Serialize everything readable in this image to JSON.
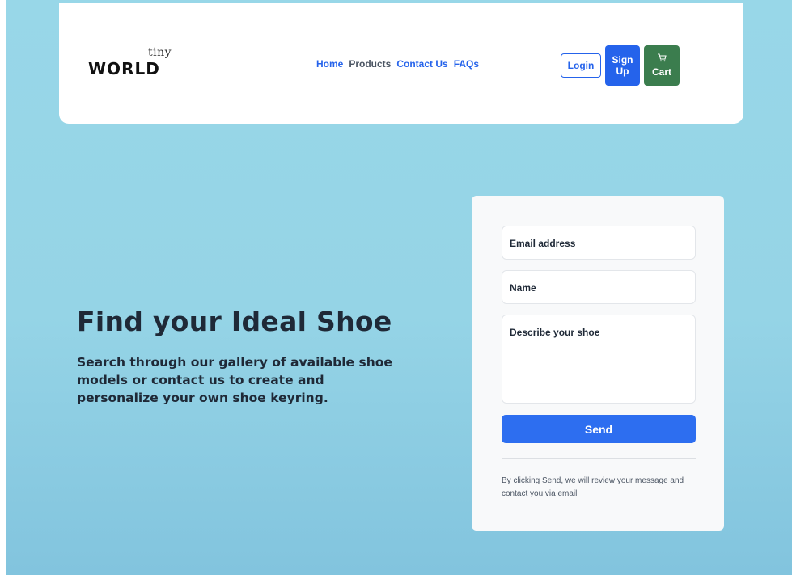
{
  "brand": {
    "tiny": "tiny",
    "world": "WORLD"
  },
  "nav": {
    "home": "Home",
    "products": "Products",
    "contact": "Contact Us",
    "faqs": "FAQs"
  },
  "auth": {
    "login": "Login",
    "signup": "Sign Up",
    "cart": "Cart",
    "cart_icon": "cart-icon"
  },
  "hero": {
    "headline": "Find your Ideal Shoe",
    "subtext": "Search through our gallery of available shoe models or contact us to create and personalize your own shoe keyring."
  },
  "form": {
    "email_placeholder": "Email address",
    "name_placeholder": "Name",
    "description_placeholder": "Describe your shoe",
    "send_label": "Send",
    "note": "By clicking Send, we will review your message and contact you via email"
  },
  "colors": {
    "primary": "#2563eb",
    "cart_green": "#3b7d4e",
    "background": "#98d7e8",
    "text": "#1f2937"
  }
}
